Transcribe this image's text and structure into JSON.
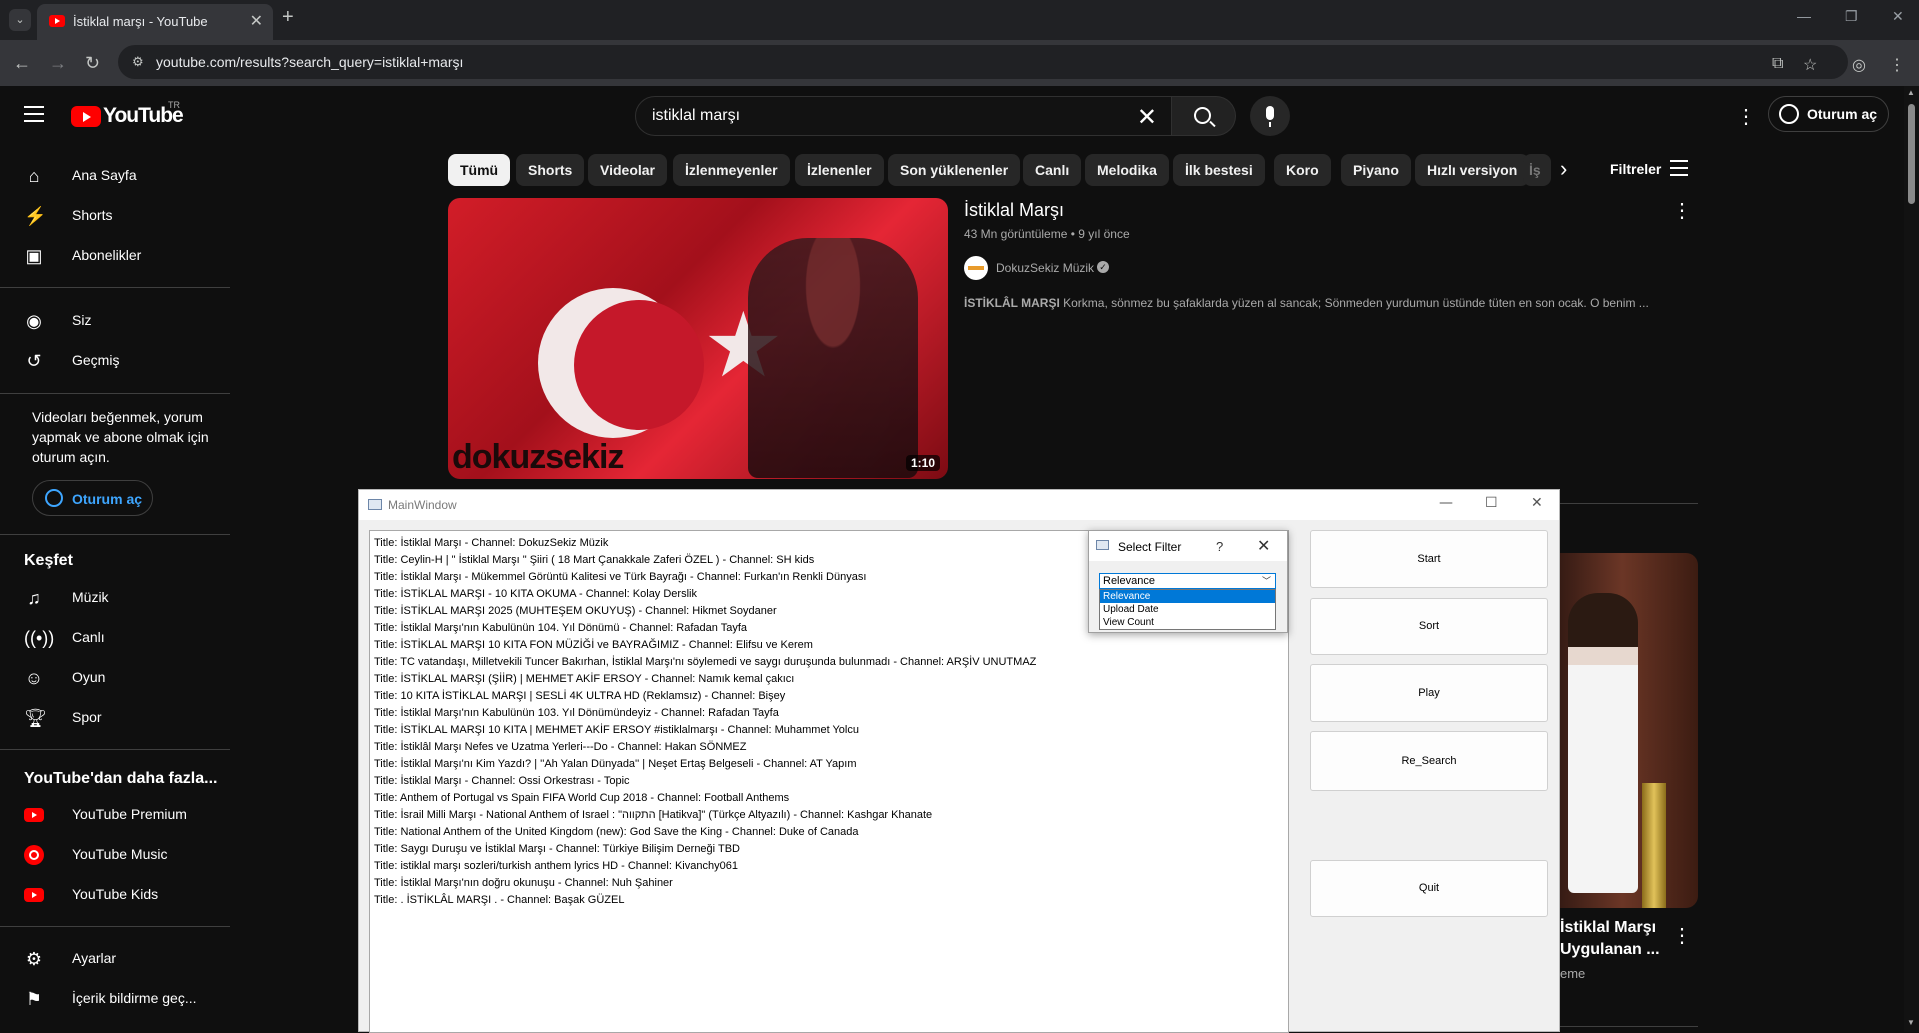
{
  "browser": {
    "tab_title": "İstiklal marşı - YouTube",
    "url": "youtube.com/results?search_query=istiklal+marşı"
  },
  "youtube": {
    "logo_text": "YouTube",
    "logo_region": "TR",
    "search_query": "istiklal marşı",
    "signin_label": "Oturum aç",
    "sidebar": {
      "main": [
        "Ana Sayfa",
        "Shorts",
        "Abonelikler"
      ],
      "you": [
        "Siz",
        "Geçmiş"
      ],
      "signin_prompt": "Videoları beğenmek, yorum yapmak ve abone olmak için oturum açın.",
      "signin_button": "Oturum aç",
      "explore_title": "Keşfet",
      "explore": [
        "Müzik",
        "Canlı",
        "Oyun",
        "Spor"
      ],
      "more_title": "YouTube'dan daha fazla...",
      "more": [
        "YouTube Premium",
        "YouTube Music",
        "YouTube Kids"
      ],
      "settings": [
        "Ayarlar",
        "İçerik bildirme geç..."
      ]
    },
    "chips": [
      "Tümü",
      "Shorts",
      "Videolar",
      "İzlenmeyenler",
      "İzlenenler",
      "Son yüklenenler",
      "Canlı",
      "Melodika",
      "İlk bestesi",
      "Koro",
      "Piyano",
      "Hızlı versiyon",
      "İş"
    ],
    "filters_label": "Filtreler",
    "result": {
      "title": "İstiklal Marşı",
      "meta": "43 Mn görüntüleme • 9 yıl önce",
      "channel": "DokuzSekiz Müzik",
      "description_bold": "İSTİKLÂL MARŞI",
      "description": " Korkma, sönmez bu şafaklarda yüzen al sancak; Sönmeden yurdumun üstünde tüten en son ocak. O benim ...",
      "duration": "1:10",
      "watermark": "dokuzsekiz"
    },
    "result2": {
      "title_line1": "İstiklal Marşı",
      "title_line2": "Uygulanan ...",
      "meta": "eme"
    }
  },
  "qt_main": {
    "title": "MainWindow",
    "list": [
      "Title: İstiklal Marşı - Channel: DokuzSekiz Müzik",
      "Title: Ceylin-H | \" İstiklal Marşı \" Şiiri ( 18 Mart Çanakkale Zaferi ÖZEL ) - Channel: SH kids",
      "Title: İstiklal Marşı - Mükemmel Görüntü Kalitesi ve Türk Bayrağı - Channel: Furkan'ın Renkli Dünyası",
      "Title: İSTİKLAL MARŞI - 10 KITA OKUMA - Channel: Kolay Derslik",
      "Title: İSTİKLAL MARŞI 2025 (MUHTEŞEM OKUYUŞ) - Channel: Hikmet Soydaner",
      "Title: İstiklal Marşı'nın Kabulünün 104. Yıl Dönümü - Channel: Rafadan Tayfa",
      "Title: İSTİKLAL MARŞI 10 KITA FON MÜZİĞİ ve BAYRAĞIMIZ - Channel: Elifsu ve Kerem",
      "Title: TC vatandaşı, Milletvekili Tuncer Bakırhan, İstiklal Marşı'nı söylemedi ve saygı duruşunda bulunmadı - Channel: ARŞİV UNUTMAZ",
      "Title: İSTİKLAL MARŞI (ŞİİR) | MEHMET AKİF ERSOY - Channel: Namık kemal çakıcı",
      "Title: 10 KITA İSTİKLAL MARŞI | SESLİ 4K ULTRA HD (Reklamsız) - Channel: Bişey",
      "Title: İstiklal Marşı'nın Kabulünün 103. Yıl Dönümündeyiz - Channel: Rafadan Tayfa",
      "Title: İSTİKLAL MARŞI 10 KITA | MEHMET AKİF ERSOY #istiklalmarşı - Channel: Muhammet Yolcu",
      "Title: İstiklâl Marşı Nefes ve Uzatma Yerleri---Do - Channel: Hakan SÖNMEZ",
      "Title: İstiklal Marşı'nı Kim Yazdı? | ''Ah Yalan Dünyada'' | Neşet Ertaş Belgeseli - Channel: AT Yapım",
      "Title: İstiklal Marşı - Channel: Ossi Orkestrası - Topic",
      "Title: Anthem of Portugal vs Spain FIFA World Cup 2018 - Channel: Football Anthems",
      "Title: İsrail Milli Marşı - National Anthem of Israel : \"התקווה [Hatikva]\" (Türkçe Altyazılı) - Channel: Kashgar Khanate",
      "Title: National Anthem of the United Kingdom (new): God Save the King - Channel: Duke of Canada",
      "Title: Saygı Duruşu ve İstiklal Marşı - Channel: Türkiye Bilişim Derneği TBD",
      "Title: istiklal marşı sozleri/turkish anthem lyrics HD - Channel: Kivanchy061",
      "Title: İstiklal Marşı'nın doğru okunuşu - Channel: Nuh Şahiner",
      "Title: . İSTİKLÂL MARŞI . - Channel: Başak GÜZEL"
    ],
    "buttons": {
      "start": "Start",
      "sort": "Sort",
      "play": "Play",
      "research": "Re_Search",
      "quit": "Quit"
    }
  },
  "qt_dialog": {
    "title": "Select Filter",
    "help": "?",
    "selected": "Relevance",
    "options": [
      "Relevance",
      "Upload Date",
      "View Count"
    ]
  }
}
